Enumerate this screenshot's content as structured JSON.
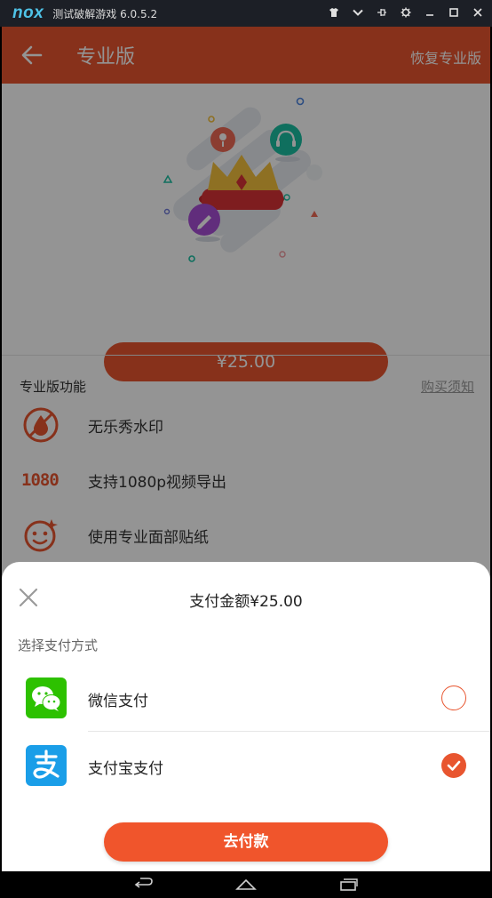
{
  "emulator": {
    "logo": "nox",
    "title": "测试破解游戏 6.0.5.2",
    "controls": [
      "shirt-icon",
      "chevron-down-icon",
      "pin-icon",
      "gear-icon",
      "minimize-icon",
      "maximize-icon",
      "close-icon"
    ]
  },
  "appbar": {
    "title": "专业版",
    "restore_label": "恢复专业版",
    "color": "#e8552f"
  },
  "price_button": "¥25.00",
  "features": {
    "title": "专业版功能",
    "notice_link": "购买须知",
    "items": [
      {
        "icon": "no-watermark-icon",
        "label": "无乐秀水印"
      },
      {
        "icon": "1080-icon",
        "label": "支持1080p视频导出",
        "icon_text": "1080"
      },
      {
        "icon": "face-sticker-icon",
        "label": "使用专业面部贴纸"
      }
    ]
  },
  "payment_sheet": {
    "title": "支付金额¥25.00",
    "subtitle": "选择支付方式",
    "methods": [
      {
        "icon": "wechat-pay-icon",
        "label": "微信支付",
        "selected": false,
        "color": "#2dc100"
      },
      {
        "icon": "alipay-icon",
        "label": "支付宝支付",
        "selected": true,
        "color": "#1a9ee8"
      }
    ],
    "confirm_label": "去付款"
  },
  "navigation": [
    "back-nav-icon",
    "home-nav-icon",
    "recents-nav-icon"
  ]
}
